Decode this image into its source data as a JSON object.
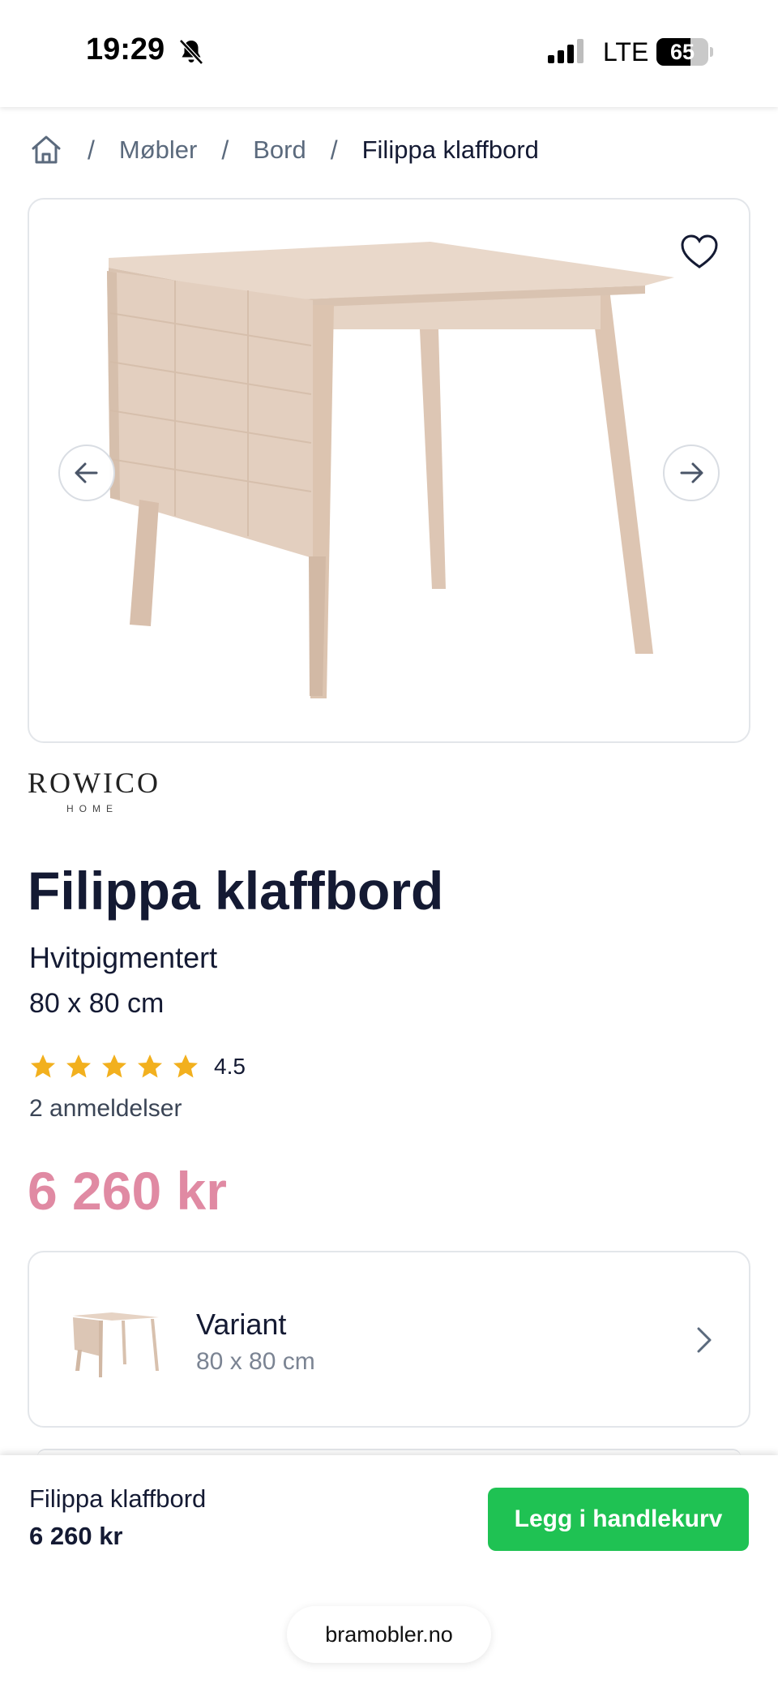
{
  "status_bar": {
    "time": "19:29",
    "network": "LTE",
    "battery_level": "65",
    "battery_fraction": 0.65,
    "icons": [
      "bell-slash-icon",
      "signal-icon",
      "battery-icon"
    ]
  },
  "breadcrumb": {
    "home_icon": "home-icon",
    "separator": "/",
    "items": [
      "Møbler",
      "Bord"
    ],
    "current": "Filippa klaffbord"
  },
  "gallery": {
    "image": "drop-leaf wooden table, white pigmented oak",
    "favorite_icon": "heart-icon",
    "prev_icon": "arrow-left-icon",
    "next_icon": "arrow-right-icon"
  },
  "brand": {
    "name": "ROWICO",
    "sub": "HOME"
  },
  "product": {
    "title": "Filippa klaffbord",
    "color": "Hvitpigmentert",
    "size": "80 x 80 cm",
    "rating": "4.5",
    "rating_stars": 5,
    "reviews": "2 anmeldelser",
    "price": "6 260 kr"
  },
  "variant": {
    "label": "Variant",
    "value": "80 x 80 cm"
  },
  "bottom_bar": {
    "name": "Filippa klaffbord",
    "price": "6 260 kr",
    "button": "Legg i handlekurv"
  },
  "browser": {
    "url": "bramobler.no"
  },
  "colors": {
    "price": "#e08aa3",
    "cta": "#1fc253",
    "star": "#f2b01e",
    "text": "#141a33",
    "muted": "#5b6a7d"
  }
}
